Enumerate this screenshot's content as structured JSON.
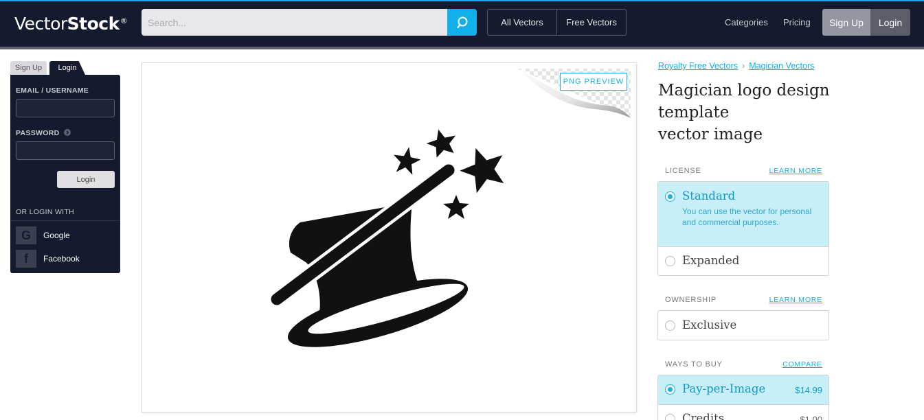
{
  "header": {
    "logo_light": "Vector",
    "logo_bold": "Stock",
    "logo_mark": "®",
    "search_placeholder": "Search...",
    "segments": [
      "All Vectors",
      "Free Vectors"
    ],
    "links": [
      "Categories",
      "Pricing"
    ],
    "signup": "Sign Up",
    "login": "Login",
    "accent": "#11b0ea",
    "bg": "#161a2e"
  },
  "login_panel": {
    "tab_signup": "Sign Up",
    "tab_login": "Login",
    "email_label": "EMAIL / USERNAME",
    "password_label": "PASSWORD",
    "login_button": "Login",
    "or_login_with": "OR LOGIN WITH",
    "google": "Google",
    "facebook": "Facebook"
  },
  "preview": {
    "png_preview": "PNG PREVIEW"
  },
  "detail": {
    "breadcrumb": [
      "Royalty Free Vectors",
      "Magician Vectors"
    ],
    "breadcrumb_sep": "›",
    "title_lines": [
      "Magician logo design",
      "template",
      "vector image"
    ],
    "license": {
      "heading": "LICENSE",
      "link": "LEARN MORE",
      "options": [
        {
          "name": "Standard",
          "desc": "You can use the vector for personal and commercial purposes.",
          "selected": true
        },
        {
          "name": "Expanded",
          "selected": false
        }
      ]
    },
    "ownership": {
      "heading": "OWNERSHIP",
      "link": "LEARN MORE",
      "options": [
        {
          "name": "Exclusive",
          "selected": false
        }
      ]
    },
    "ways_to_buy": {
      "heading": "WAYS TO BUY",
      "link": "COMPARE",
      "options": [
        {
          "name": "Pay-per-Image",
          "price": "$14.99",
          "selected": true
        },
        {
          "name": "Credits",
          "price": "$1.00",
          "selected": false
        }
      ]
    }
  }
}
